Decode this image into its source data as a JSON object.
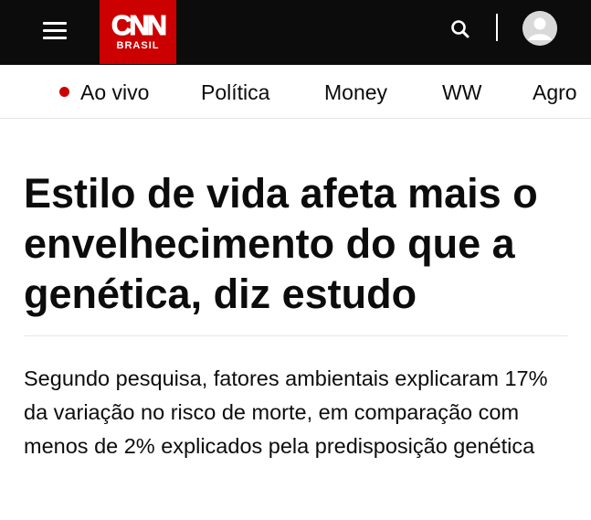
{
  "header": {
    "logo": {
      "mark": "CNN",
      "edition": "BRASIL"
    },
    "icons": [
      "menu-icon",
      "search-icon",
      "user-avatar-icon"
    ],
    "colors": {
      "bar": "#0c0c0c",
      "brand_red": "#cc0000"
    }
  },
  "nav": {
    "items": [
      {
        "label": "Ao vivo",
        "live": true
      },
      {
        "label": "Política"
      },
      {
        "label": "Money"
      },
      {
        "label": "WW"
      },
      {
        "label": "Agro"
      }
    ]
  },
  "article": {
    "headline": "Estilo de vida afeta mais o envelhecimento do que a genética, diz estudo",
    "subheadline": "Segundo pesquisa, fatores ambientais explicaram 17% da variação no risco de morte, em comparação com menos de 2% explicados pela predisposição genética"
  }
}
